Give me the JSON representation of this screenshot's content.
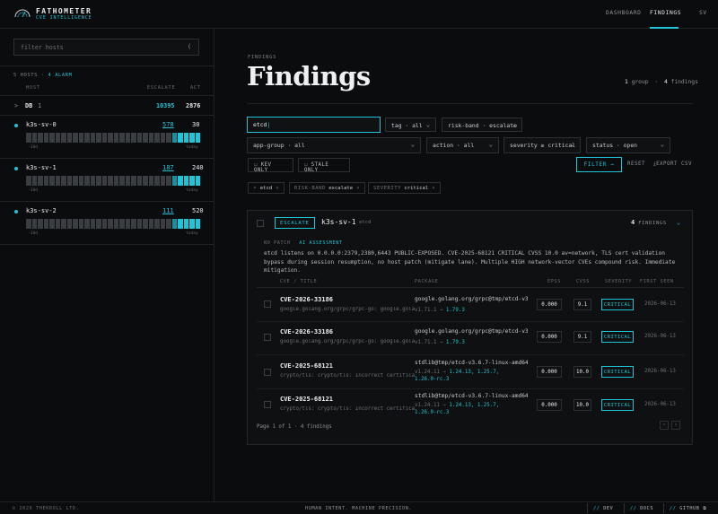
{
  "app": {
    "name": "FATHOMETER",
    "subtitle": "CVE INTELLIGENCE"
  },
  "nav": {
    "dashboard": "DASHBOARD",
    "findings": "FINDINGS",
    "user": "SV"
  },
  "sidebar": {
    "filter_placeholder": "filter hosts",
    "filter_icon": "(",
    "meta_hosts": "5 HOSTS",
    "meta_sep": "·",
    "meta_alarm": "4 ALARM",
    "col_host": "HOST",
    "col_escalate": "ESCALATE",
    "col_act": "ACT",
    "group": {
      "chevron": ">",
      "name": "DB",
      "count": "1",
      "escalate": "10395",
      "act": "2876"
    },
    "hosts": [
      {
        "name": "k3s-sv-0",
        "escalate": "578",
        "act": "30",
        "label_left": "-30d",
        "label_right": "today"
      },
      {
        "name": "k3s-sv-1",
        "escalate": "187",
        "act": "240",
        "label_left": "-30d",
        "label_right": "today"
      },
      {
        "name": "k3s-sv-2",
        "escalate": "111",
        "act": "520",
        "label_left": "-30d",
        "label_right": "today"
      }
    ]
  },
  "main": {
    "crumb": "FINDINGS",
    "title": "Findings",
    "count_groups": "1",
    "count_groups_label": "group",
    "count_findings": "4",
    "count_findings_label": "findings",
    "search_value": "etcd",
    "filters": {
      "tag": "tag · all",
      "risk_band": "risk-band · escalate",
      "app_group": "app-group · all",
      "action": "action · all",
      "severity": "severity ≥ critical",
      "status": "status · open"
    },
    "kev_only": "KEV ONLY",
    "stale_only": "STALE ONLY",
    "filter_btn": "FILTER →",
    "reset_btn": "RESET",
    "export_btn": "EXPORT CSV",
    "chips": [
      {
        "key": "",
        "value": "etcd"
      },
      {
        "key": "RISK-BAND",
        "value": "escalate"
      },
      {
        "key": "SEVERITY",
        "value": "critical"
      }
    ],
    "card": {
      "badge": "ESCALATE",
      "host": "k3s-sv-1",
      "tag": "etcd",
      "count": "4",
      "count_label": "FINDINGS",
      "no_patch": "NO PATCH",
      "ai_label": "AI ASSESSMENT",
      "summary": "etcd listens on 0.0.0.0:2379,2380,6443 PUBLIC-EXPOSED. CVE-2025-68121 CRITICAL CVSS 10.0 av=network, TLS cert validation bypass during session resumption, no host patch (mitigate lane). Multiple HIGH network-vector CVEs compound risk. Immediate mitigation.",
      "columns": {
        "cve": "CVE / TITLE",
        "package": "PACKAGE",
        "epss": "EPSS",
        "cvss": "CVSS",
        "severity": "SEVERITY",
        "first_seen": "FIRST SEEN"
      },
      "rows": [
        {
          "cve": "CVE-2026-33186",
          "desc": "google.golang.org/grpc/grpc-go: google.golang.org/grpc",
          "package": "google.golang.org/grpc@tmp/etcd-v3.6.7",
          "installed": "v1.71.1",
          "fixes": "1.79.3",
          "epss": "0.000",
          "cvss": "9.1",
          "severity": "CRITICAL",
          "first_seen": "2026-06-13"
        },
        {
          "cve": "CVE-2026-33186",
          "desc": "google.golang.org/grpc/grpc-go: google.golang.org/grpc",
          "package": "google.golang.org/grpc@tmp/etcd-v3.6.7",
          "installed": "v1.71.1",
          "fixes": "1.79.3",
          "epss": "0.000",
          "cvss": "9.1",
          "severity": "CRITICAL",
          "first_seen": "2026-06-13"
        },
        {
          "cve": "CVE-2025-68121",
          "desc": "crypto/tls: crypto/tls: Incorrect certificate validation",
          "package": "stdlib@tmp/etcd-v3.6.7-linux-amd64",
          "installed": "v1.24.11",
          "fixes": "1.24.13, 1.25.7,",
          "fixes2": "1.26.0-rc.3",
          "epss": "0.000",
          "cvss": "10.0",
          "severity": "CRITICAL",
          "first_seen": "2026-06-13"
        },
        {
          "cve": "CVE-2025-68121",
          "desc": "crypto/tls: crypto/tls: Incorrect certificate validation",
          "package": "stdlib@tmp/etcd-v3.6.7-linux-amd64",
          "installed": "v1.24.11",
          "fixes": "1.24.13, 1.25.7,",
          "fixes2": "1.26.0-rc.3",
          "epss": "0.000",
          "cvss": "10.0",
          "severity": "CRITICAL",
          "first_seen": "2026-06-13"
        }
      ],
      "pager": "Page 1 of 1 · 4 findings"
    }
  },
  "footer": {
    "copyright": "© 2026 THEKROLL LTD.",
    "tagline": "HUMAN INTENT. MACHINE PRECISION.",
    "dev": "DEV",
    "docs": "DOCS",
    "github": "GITHUB"
  },
  "colors": {
    "accent": "#21c4d6",
    "background": "#0b0c0d"
  },
  "icons": [
    "logo-arc-icon",
    "chevron-down-icon",
    "checkbox-icon",
    "external-link-icon"
  ]
}
